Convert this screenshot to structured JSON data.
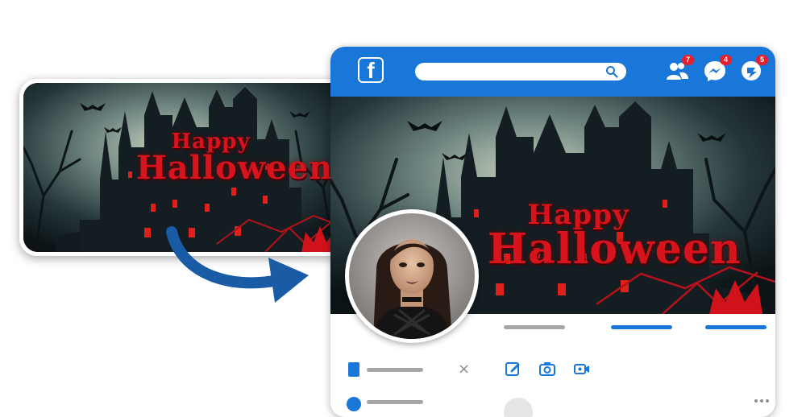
{
  "cover": {
    "line1": "Happy",
    "line2": "Halloween"
  },
  "topbar": {
    "logo_letter": "f",
    "search_placeholder": "",
    "friend_requests_count": "7",
    "messages_count": "4",
    "notifications_count": "5"
  },
  "profile_actions": {
    "close_label": "×"
  },
  "colors": {
    "brand_blue": "#1877d8",
    "badge_red": "#e4202c",
    "placeholder_grey": "#a6a6a6",
    "halloween_red": "#d7141d"
  },
  "icons": [
    "facebook-logo-icon",
    "search-icon",
    "friends-icon",
    "messenger-icon",
    "notifications-icon",
    "edit-icon",
    "camera-icon",
    "video-icon",
    "close-icon",
    "arrow-icon",
    "more-icon"
  ]
}
